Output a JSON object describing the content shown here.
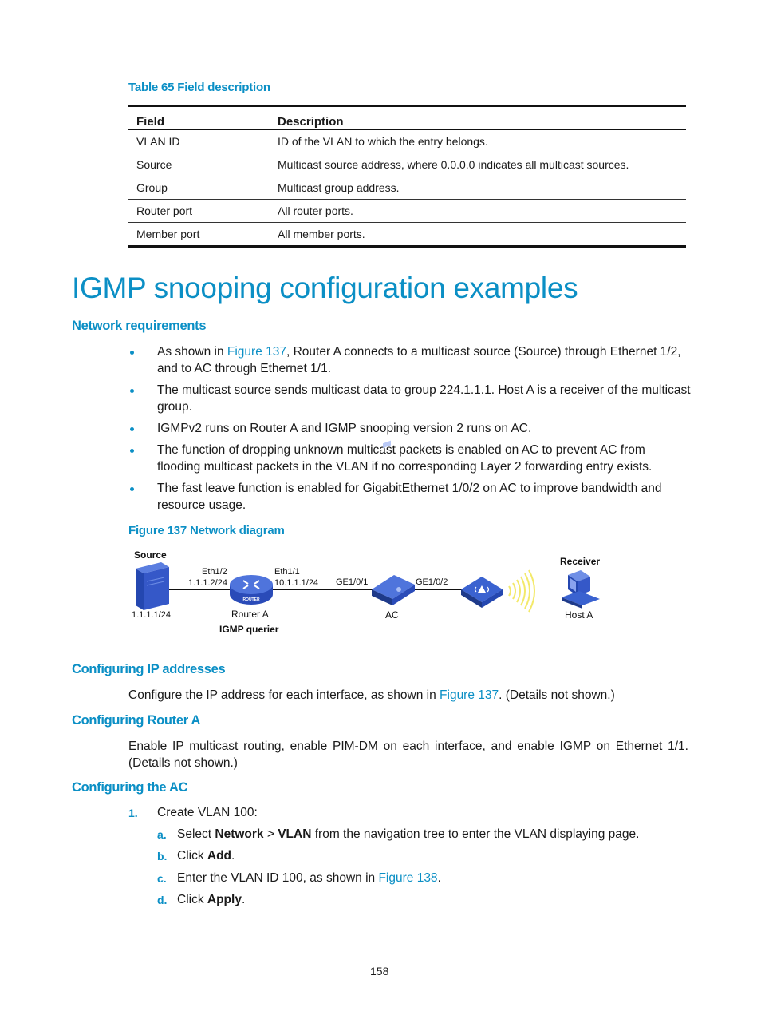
{
  "table": {
    "caption": "Table 65 Field description",
    "headers": [
      "Field",
      "Description"
    ],
    "rows": [
      [
        "VLAN ID",
        "ID of the VLAN to which the entry belongs."
      ],
      [
        "Source",
        "Multicast source address, where 0.0.0.0 indicates all multicast sources."
      ],
      [
        "Group",
        "Multicast group address."
      ],
      [
        "Router port",
        "All router ports."
      ],
      [
        "Member port",
        "All member ports."
      ]
    ]
  },
  "title": "IGMP snooping configuration examples",
  "network_requirements": {
    "heading": "Network requirements",
    "bullets": [
      {
        "pre": "As shown in ",
        "link": "Figure 137",
        "post": ", Router A connects to a multicast source (Source) through Ethernet 1/2, and to AC through Ethernet 1/1."
      },
      {
        "pre": "The multicast source sends multicast data to group 224.1.1.1. Host A is a receiver of the multicast group.",
        "link": "",
        "post": ""
      },
      {
        "pre": "IGMPv2 runs on Router A and IGMP snooping version 2 runs on AC.",
        "link": "",
        "post": ""
      },
      {
        "pre": "The function of dropping unknown multicast packets is enabled on AC to prevent AC from flooding multicast packets in the VLAN if no corresponding Layer 2 forwarding entry exists.",
        "link": "",
        "post": ""
      },
      {
        "pre": "The fast leave function is enabled for GigabitEthernet 1/0/2 on AC to improve bandwidth and resource usage.",
        "link": "",
        "post": ""
      }
    ]
  },
  "figure": {
    "caption": "Figure 137 Network diagram",
    "labels": {
      "source": "Source",
      "source_ip": "1.1.1.1/24",
      "eth12": "Eth1/2",
      "eth12_ip": "1.1.1.2/24",
      "eth11": "Eth1/1",
      "eth11_ip": "10.1.1.1/24",
      "router_name": "Router A",
      "router_role": "IGMP querier",
      "router_badge": "ROUTER",
      "ge101": "GE1/0/1",
      "ge102": "GE1/0/2",
      "ac": "AC",
      "receiver": "Receiver",
      "host": "Host A"
    },
    "colors": {
      "device_blue": "#3a5fc8",
      "device_dark": "#1e3a8a",
      "wave_yellow": "#f3e96a"
    }
  },
  "ip_section": {
    "heading": "Configuring IP addresses",
    "pre": "Configure the IP address for each interface, as shown in ",
    "link": "Figure 137",
    "post": ". (Details not shown.)"
  },
  "router_section": {
    "heading": "Configuring Router A",
    "text": "Enable IP multicast routing, enable PIM-DM on each interface, and enable IGMP on Ethernet 1/1. (Details not shown.)"
  },
  "ac_section": {
    "heading": "Configuring the AC",
    "steps": [
      {
        "num": "1.",
        "text": "Create VLAN 100:",
        "substeps": [
          {
            "letter": "a.",
            "pre": "Select ",
            "bold1": "Network",
            "mid": " > ",
            "bold2": "VLAN",
            "post": " from the navigation tree to enter the VLAN displaying page."
          },
          {
            "letter": "b.",
            "pre": "Click ",
            "bold1": "Add",
            "post": "."
          },
          {
            "letter": "c.",
            "pre": "Enter the VLAN ID 100, as shown in ",
            "link": "Figure 138",
            "post": "."
          },
          {
            "letter": "d.",
            "pre": "Click ",
            "bold1": "Apply",
            "post": "."
          }
        ]
      }
    ]
  },
  "page_number": "158"
}
